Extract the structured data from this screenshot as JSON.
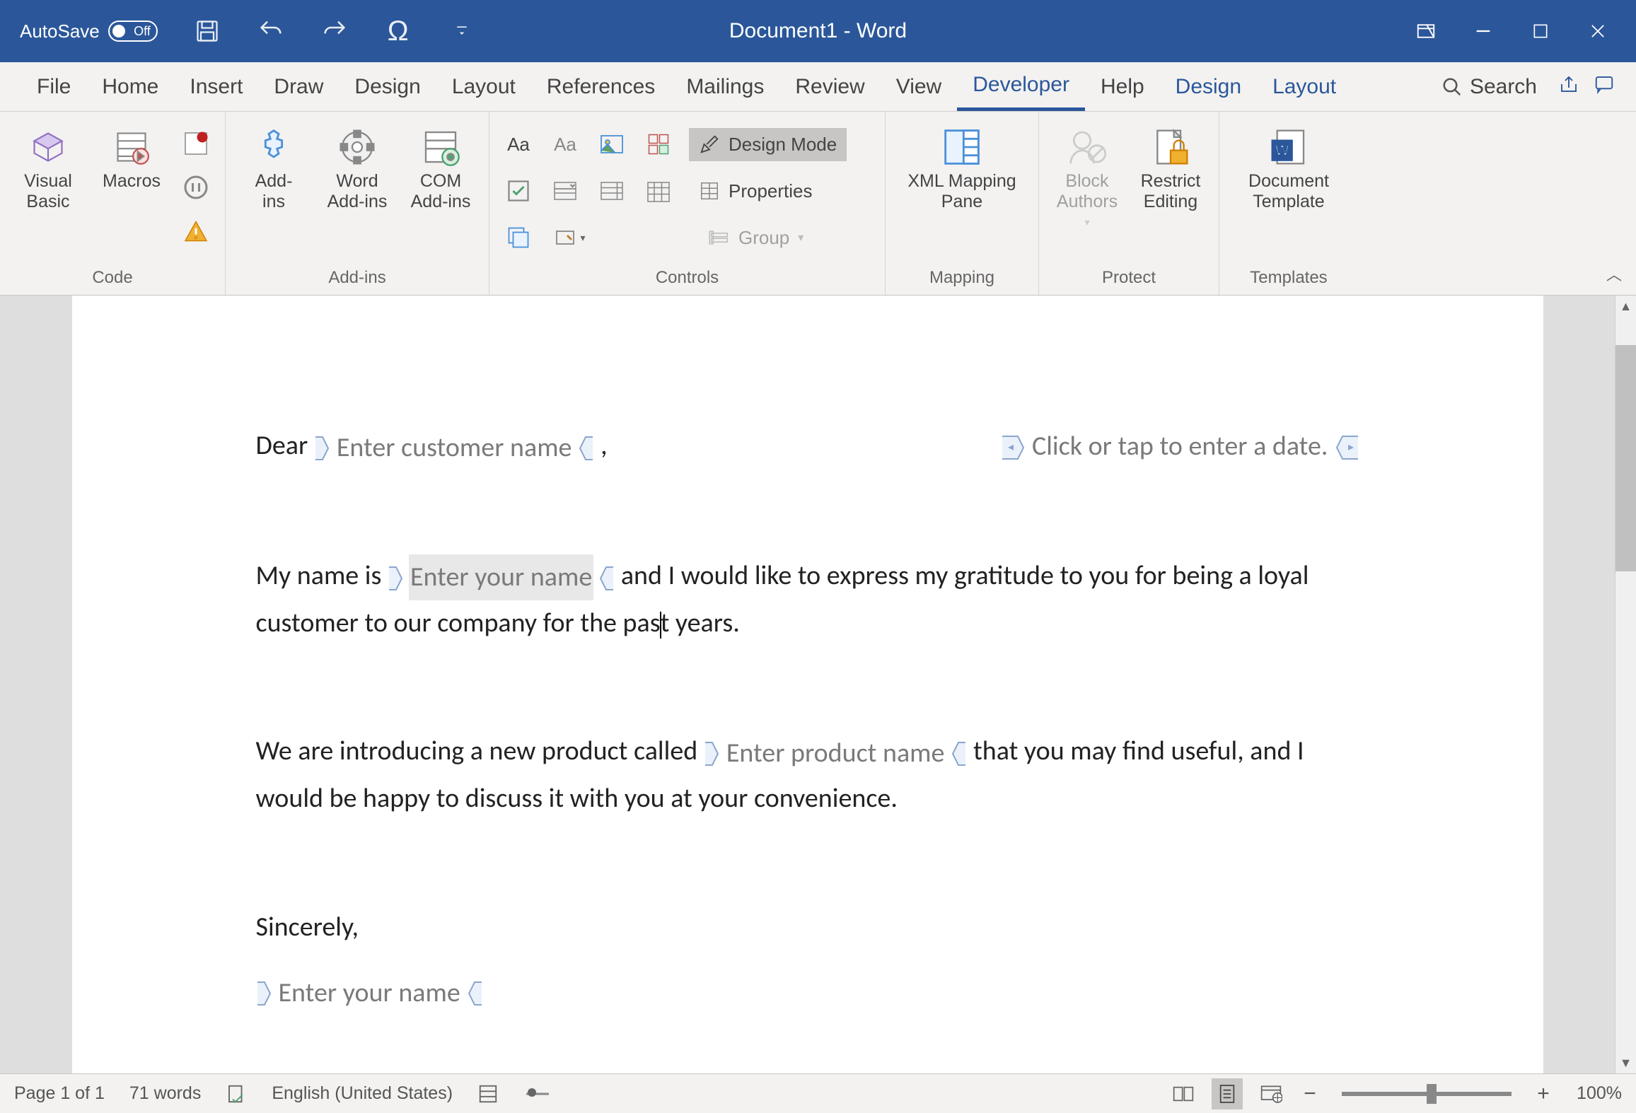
{
  "titlebar": {
    "autosave_label": "AutoSave",
    "autosave_state": "Off",
    "doc_title": "Document1  -  Word"
  },
  "tabs": {
    "file": "File",
    "home": "Home",
    "insert": "Insert",
    "draw": "Draw",
    "design": "Design",
    "layout": "Layout",
    "references": "References",
    "mailings": "Mailings",
    "review": "Review",
    "view": "View",
    "developer": "Developer",
    "help": "Help",
    "ctx_design": "Design",
    "ctx_layout": "Layout",
    "search": "Search"
  },
  "ribbon": {
    "code": {
      "visual_basic": "Visual\nBasic",
      "macros": "Macros",
      "label": "Code"
    },
    "addins": {
      "addins": "Add-\nins",
      "word_addins": "Word\nAdd-ins",
      "com_addins": "COM\nAdd-ins",
      "label": "Add-ins"
    },
    "controls": {
      "design_mode": "Design Mode",
      "properties": "Properties",
      "group": "Group",
      "label": "Controls"
    },
    "mapping": {
      "xml_pane": "XML Mapping\nPane",
      "label": "Mapping"
    },
    "protect": {
      "block_authors": "Block\nAuthors",
      "restrict_editing": "Restrict\nEditing",
      "label": "Protect"
    },
    "templates": {
      "doc_template": "Document\nTemplate",
      "label": "Templates"
    }
  },
  "document": {
    "greeting_prefix": "Dear ",
    "greeting_suffix": ",",
    "cc_customer_name": "Enter customer name",
    "cc_date": "Click or tap to enter a date.",
    "para1_a": "My name is ",
    "cc_your_name": "Enter your name",
    "para1_b": " and I would like to express my gratitude to you for being a loyal customer to our company for the pas",
    "para1_c": "t years.",
    "para2_a": "We are introducing a new product called ",
    "cc_product_name": "Enter product name",
    "para2_b": " that you may find useful, and I would be happy to discuss it with you at your convenience.",
    "closing": "Sincerely,",
    "cc_signature": "Enter your name"
  },
  "statusbar": {
    "page": "Page 1 of 1",
    "words": "71 words",
    "language": "English (United States)",
    "zoom": "100%"
  }
}
